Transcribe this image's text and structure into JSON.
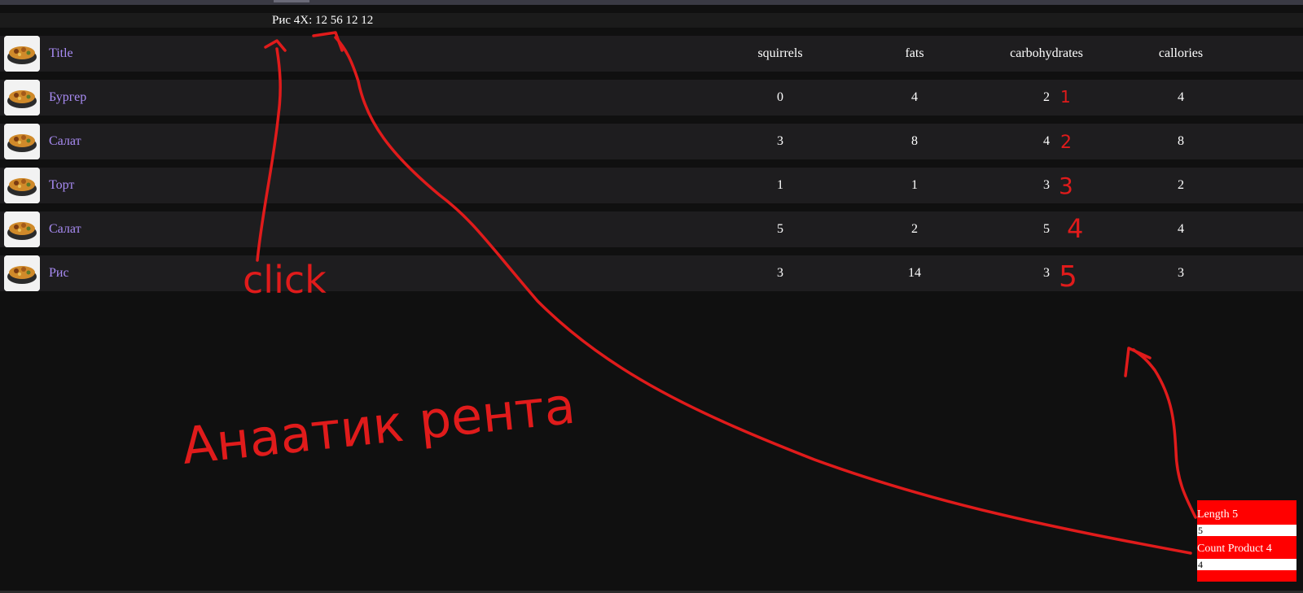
{
  "summary": {
    "text": "Рис 4X: 12 56 12 12"
  },
  "header": {
    "title": "Title",
    "col_squirrels": "squirrels",
    "col_fats": "fats",
    "col_carbohydrates": "carbohydrates",
    "col_callories": "callories"
  },
  "rows": [
    {
      "title": "Бургер",
      "squirrels": "0",
      "fats": "4",
      "carbohydrates": "2",
      "callories": "4"
    },
    {
      "title": "Салат",
      "squirrels": "3",
      "fats": "8",
      "carbohydrates": "4",
      "callories": "8"
    },
    {
      "title": "Торт",
      "squirrels": "1",
      "fats": "1",
      "carbohydrates": "3",
      "callories": "2"
    },
    {
      "title": "Салат",
      "squirrels": "5",
      "fats": "2",
      "carbohydrates": "5",
      "callories": "4"
    },
    {
      "title": "Рис",
      "squirrels": "3",
      "fats": "14",
      "carbohydrates": "3",
      "callories": "3"
    }
  ],
  "panel": {
    "length_label": "Length 5",
    "length_value": "5",
    "count_label": "Count Product 4",
    "count_value": "4"
  },
  "annotations": {
    "click_text": "click",
    "main_text": "Анаатик рента",
    "numbers": [
      "1",
      "2",
      "3",
      "4",
      "5"
    ]
  },
  "colors": {
    "link": "#a98cf5",
    "annotation": "#e01b1b",
    "panel": "#ff0000",
    "row_bg": "#1e1d1f"
  }
}
